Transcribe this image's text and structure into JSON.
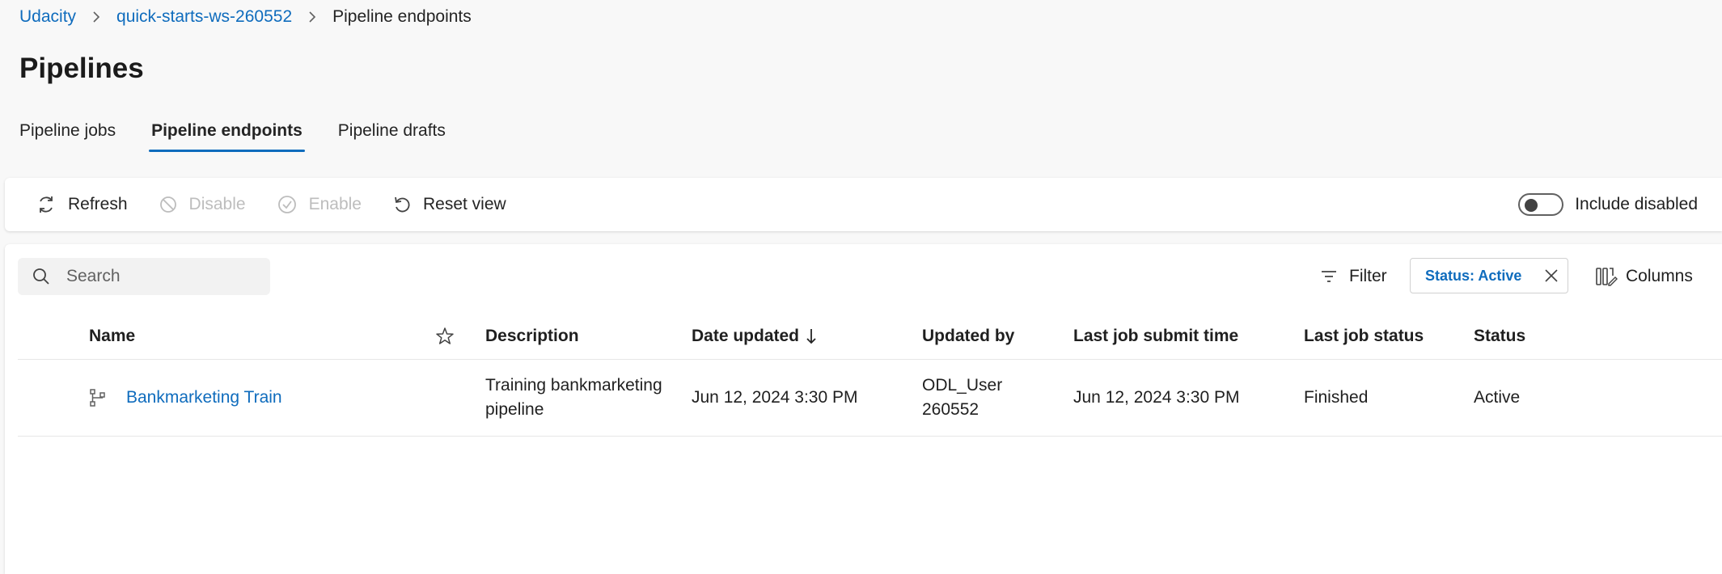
{
  "breadcrumb": {
    "items": [
      "Udacity",
      "quick-starts-ws-260552"
    ],
    "current": "Pipeline endpoints"
  },
  "page": {
    "title": "Pipelines"
  },
  "tabs": [
    {
      "label": "Pipeline jobs",
      "active": false
    },
    {
      "label": "Pipeline endpoints",
      "active": true
    },
    {
      "label": "Pipeline drafts",
      "active": false
    }
  ],
  "toolbar": {
    "refresh": "Refresh",
    "disable": "Disable",
    "enable": "Enable",
    "reset_view": "Reset view",
    "include_disabled": "Include disabled"
  },
  "search": {
    "placeholder": "Search"
  },
  "filters": {
    "filter_label": "Filter",
    "chip": "Status: Active",
    "columns_label": "Columns"
  },
  "table": {
    "headers": {
      "name": "Name",
      "description": "Description",
      "date_updated": "Date updated",
      "updated_by": "Updated by",
      "last_job_submit_time": "Last job submit time",
      "last_job_status": "Last job status",
      "status": "Status"
    },
    "rows": [
      {
        "name": "Bankmarketing Train",
        "description_line1": "Training bankmarketing",
        "description_line2": "pipeline",
        "date_updated": "Jun 12, 2024 3:30 PM",
        "updated_by_line1": "ODL_User",
        "updated_by_line2": "260552",
        "last_job_submit_time": "Jun 12, 2024 3:30 PM",
        "last_job_status": "Finished",
        "status": "Active"
      }
    ]
  },
  "colors": {
    "accent": "#0f6cbd",
    "disabled": "#bdbdbd",
    "text": "#242424"
  }
}
